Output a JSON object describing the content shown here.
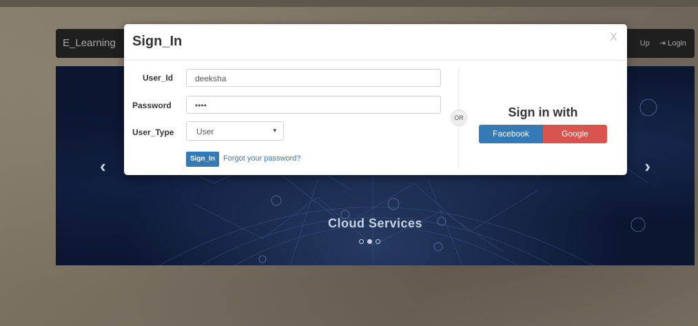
{
  "navbar": {
    "brand": "E_Learning",
    "signup_label": "Up",
    "login_label": "Login"
  },
  "carousel": {
    "caption": "Cloud Services",
    "prev_glyph": "‹",
    "next_glyph": "›"
  },
  "modal": {
    "title": "Sign_In",
    "close_label": "X",
    "user_id_label": "User_Id",
    "user_id_value": "deeksha",
    "password_label": "Password",
    "password_value": "••••",
    "user_type_label": "User_Type",
    "user_type_value": "User",
    "signin_button": "Sign_In",
    "forgot_link": "Forgot your password?",
    "or_label": "OR",
    "signin_with": "Sign in with",
    "facebook_label": "Facebook",
    "google_label": "Google"
  },
  "colors": {
    "primary": "#337ab7",
    "danger": "#d9534f",
    "navbar": "#1f1f1f",
    "carousel_bg": "#0b1631"
  }
}
